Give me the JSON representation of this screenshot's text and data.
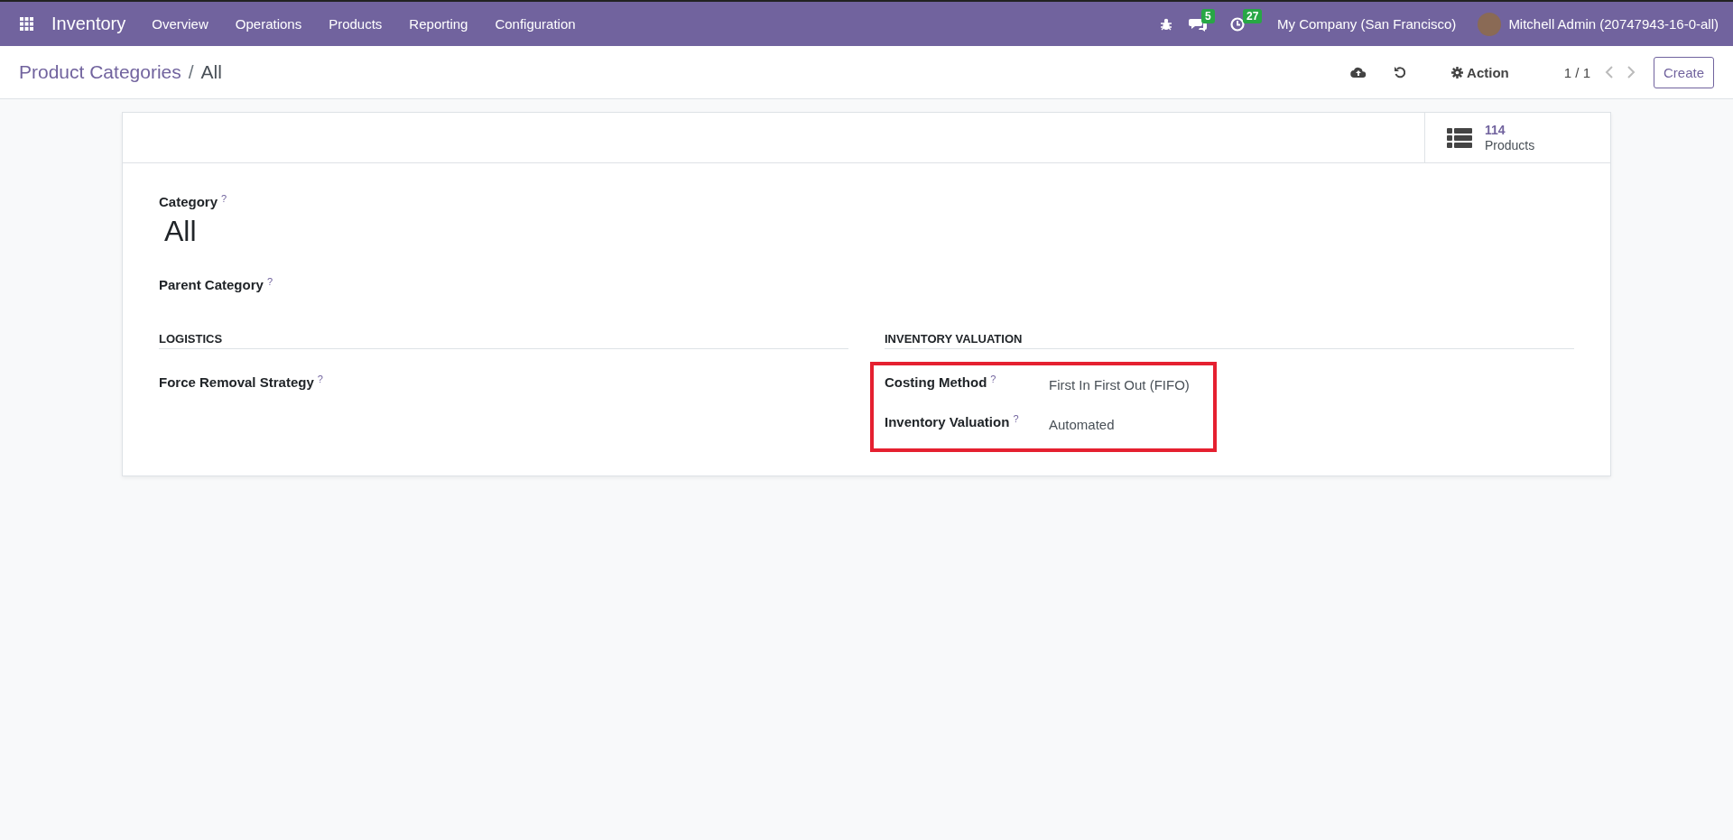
{
  "navbar": {
    "app_name": "Inventory",
    "menu": [
      "Overview",
      "Operations",
      "Products",
      "Reporting",
      "Configuration"
    ],
    "messages_count": "5",
    "activities_count": "27",
    "company": "My Company (San Francisco)",
    "user": "Mitchell Admin (20747943-16-0-all)"
  },
  "control_panel": {
    "breadcrumb_separator": "/",
    "breadcrumb": [
      {
        "label": "Product Categories",
        "selected": false
      },
      {
        "label": "All",
        "selected": true
      }
    ],
    "action": "Action",
    "pager": "1 / 1",
    "create": "Create"
  },
  "smart_button": {
    "count": "114",
    "label": "Products"
  },
  "form": {
    "category": {
      "label": "Category",
      "help": "?",
      "value": "All"
    },
    "parent": {
      "label": "Parent Category",
      "help": "?"
    },
    "groups": [
      {
        "title": "LOGISTICS",
        "highlighted": false,
        "fields": [
          {
            "label": "Force Removal Strategy",
            "help": "?"
          }
        ]
      },
      {
        "title": "INVENTORY VALUATION",
        "highlighted": true,
        "fields": [
          {
            "label": "Costing Method",
            "help": "?",
            "value": "First In First Out (FIFO)"
          },
          {
            "label": "Inventory Valuation",
            "help": "?",
            "value": "Automated"
          }
        ]
      }
    ]
  }
}
